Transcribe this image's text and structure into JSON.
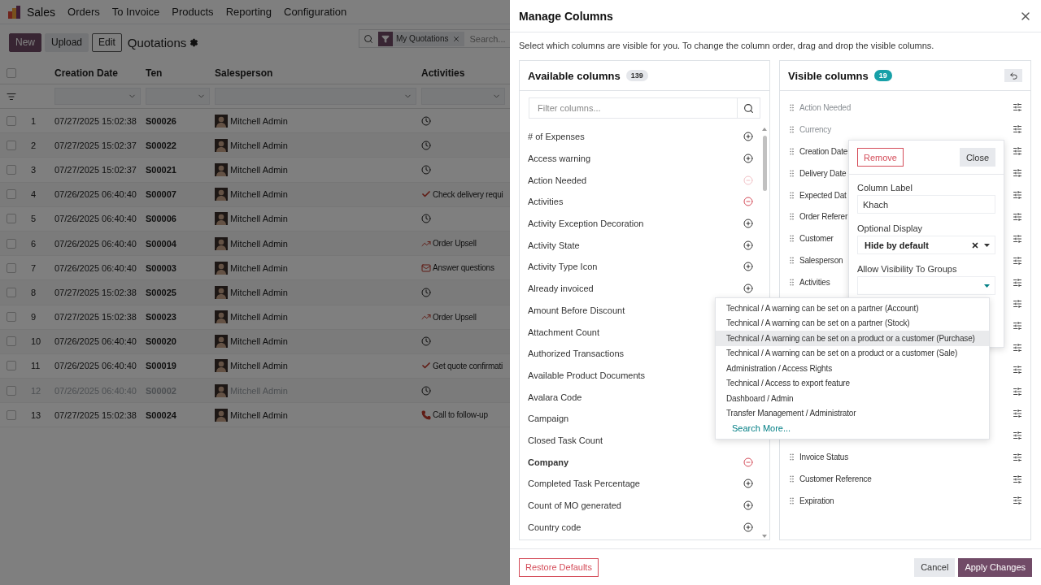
{
  "app": {
    "name": "Sales",
    "menu": [
      "Orders",
      "To Invoice",
      "Products",
      "Reporting",
      "Configuration"
    ]
  },
  "select_all": {
    "checked": false
  },
  "control_panel": {
    "buttons": [
      {
        "label": "New",
        "kind": "primary"
      },
      {
        "label": "Upload",
        "kind": "secondary"
      },
      {
        "label": "Edit",
        "kind": "outline"
      }
    ],
    "title": "Quotations",
    "search": {
      "facet": "My Quotations",
      "placeholder": "Search..."
    }
  },
  "table": {
    "columns": [
      "Creation Date",
      "Ten",
      "Salesperson",
      "Activities"
    ],
    "rows": [
      {
        "index": "1",
        "date": "07/27/2025 15:02:38",
        "ref": "S00026",
        "salesperson": "Mitchell Admin",
        "activity": {
          "kind": "clock"
        },
        "muted": false,
        "checked": false
      },
      {
        "index": "2",
        "date": "07/27/2025 15:02:37",
        "ref": "S00022",
        "salesperson": "Mitchell Admin",
        "activity": {
          "kind": "clock"
        },
        "muted": false,
        "checked": false
      },
      {
        "index": "3",
        "date": "07/27/2025 15:02:37",
        "ref": "S00021",
        "salesperson": "Mitchell Admin",
        "activity": {
          "kind": "clock"
        },
        "muted": false,
        "checked": false
      },
      {
        "index": "4",
        "date": "07/26/2025 06:40:40",
        "ref": "S00007",
        "salesperson": "Mitchell Admin",
        "activity": {
          "kind": "todo",
          "text": "Check delivery requi"
        },
        "muted": false,
        "checked": false
      },
      {
        "index": "5",
        "date": "07/26/2025 06:40:40",
        "ref": "S00006",
        "salesperson": "Mitchell Admin",
        "activity": {
          "kind": "clock"
        },
        "muted": false,
        "checked": false
      },
      {
        "index": "6",
        "date": "07/26/2025 06:40:40",
        "ref": "S00004",
        "salesperson": "Mitchell Admin",
        "activity": {
          "kind": "upsell",
          "text": "Order Upsell"
        },
        "muted": false,
        "checked": false
      },
      {
        "index": "7",
        "date": "07/26/2025 06:40:40",
        "ref": "S00003",
        "salesperson": "Mitchell Admin",
        "activity": {
          "kind": "email",
          "text": "Answer questions"
        },
        "muted": false,
        "checked": false
      },
      {
        "index": "8",
        "date": "07/27/2025 15:02:38",
        "ref": "S00025",
        "salesperson": "Mitchell Admin",
        "activity": {
          "kind": "clock"
        },
        "muted": false,
        "checked": false
      },
      {
        "index": "9",
        "date": "07/27/2025 15:02:38",
        "ref": "S00023",
        "salesperson": "Mitchell Admin",
        "activity": {
          "kind": "upsell",
          "text": "Order Upsell"
        },
        "muted": false,
        "checked": false
      },
      {
        "index": "10",
        "date": "07/26/2025 06:40:40",
        "ref": "S00020",
        "salesperson": "Mitchell Admin",
        "activity": {
          "kind": "clock"
        },
        "muted": false,
        "checked": false
      },
      {
        "index": "11",
        "date": "07/26/2025 06:40:40",
        "ref": "S00019",
        "salesperson": "Mitchell Admin",
        "activity": {
          "kind": "todo",
          "text": "Get quote confirmati"
        },
        "muted": false,
        "checked": false
      },
      {
        "index": "12",
        "date": "07/26/2025 06:40:40",
        "ref": "S00002",
        "salesperson": "Mitchell Admin",
        "activity": {
          "kind": "clock"
        },
        "muted": true,
        "checked": false
      },
      {
        "index": "13",
        "date": "07/27/2025 15:02:38",
        "ref": "S00024",
        "salesperson": "Mitchell Admin",
        "activity": {
          "kind": "call",
          "text": "Call to follow-up"
        },
        "muted": false,
        "checked": false
      }
    ]
  },
  "dialog": {
    "title": "Manage Columns",
    "description": "Select which columns are visible for you. To change the column order, drag and drop the visible columns.",
    "available": {
      "title": "Available columns",
      "count": "139",
      "filter_placeholder": "Filter columns...",
      "items": [
        {
          "label": "# of Expenses",
          "in_view": false,
          "faded": false,
          "bold": false
        },
        {
          "label": "Access warning",
          "in_view": false,
          "faded": false,
          "bold": false
        },
        {
          "label": "Action Needed",
          "in_view": true,
          "faded": true,
          "bold": false
        },
        {
          "label": "Activities",
          "in_view": true,
          "faded": false,
          "bold": false
        },
        {
          "label": "Activity Exception Decoration",
          "in_view": false,
          "faded": false,
          "bold": false
        },
        {
          "label": "Activity State",
          "in_view": false,
          "faded": false,
          "bold": false
        },
        {
          "label": "Activity Type Icon",
          "in_view": false,
          "faded": false,
          "bold": false
        },
        {
          "label": "Already invoiced",
          "in_view": false,
          "faded": false,
          "bold": false
        },
        {
          "label": "Amount Before Discount",
          "bold": false
        },
        {
          "label": "Attachment Count",
          "bold": false
        },
        {
          "label": "Authorized Transactions",
          "bold": false
        },
        {
          "label": "Available Product Documents",
          "bold": false
        },
        {
          "label": "Avalara Code",
          "bold": false
        },
        {
          "label": "Campaign",
          "bold": false
        },
        {
          "label": "Closed Task Count",
          "bold": false
        },
        {
          "label": "Company",
          "in_view": true,
          "faded": false,
          "bold": true
        },
        {
          "label": "Completed Task Percentage",
          "in_view": false,
          "faded": false,
          "bold": false
        },
        {
          "label": "Count of MO generated",
          "in_view": false,
          "faded": false,
          "bold": false
        },
        {
          "label": "Country code",
          "in_view": false,
          "faded": false,
          "bold": false
        }
      ]
    },
    "visible": {
      "title": "Visible columns",
      "count": "19",
      "items": [
        {
          "kind": "column",
          "label": "Action Needed",
          "faded": true
        },
        {
          "kind": "column",
          "label": "Currency",
          "faded": true
        },
        {
          "kind": "column",
          "label": "Creation Date",
          "faded": false
        },
        {
          "kind": "column",
          "label": "Delivery Date",
          "faded": false
        },
        {
          "kind": "column",
          "label": "Expected Dat",
          "faded": false
        },
        {
          "kind": "column",
          "label": "Order Referer",
          "faded": false
        },
        {
          "kind": "column",
          "label": "Customer",
          "faded": false
        },
        {
          "kind": "column",
          "label": "Salesperson",
          "faded": false
        },
        {
          "kind": "column",
          "label": "Activities",
          "faded": false
        },
        {
          "kind": "covered"
        },
        {
          "kind": "covered"
        },
        {
          "kind": "covered"
        },
        {
          "kind": "covered"
        },
        {
          "kind": "covered"
        },
        {
          "kind": "covered"
        },
        {
          "kind": "covered"
        },
        {
          "kind": "column",
          "label": "Invoice Status",
          "faded": false
        },
        {
          "kind": "column",
          "label": "Customer Reference",
          "faded": false
        },
        {
          "kind": "column",
          "label": "Expiration",
          "faded": false
        }
      ]
    },
    "column_popover": {
      "remove": "Remove",
      "close": "Close",
      "fields": [
        {
          "label": "Column Label",
          "kind": "text",
          "value": "Khach"
        },
        {
          "label": "Optional Display",
          "kind": "select",
          "value": "Hide by default",
          "clearable": true
        },
        {
          "label": "Allow Visibility To Groups",
          "kind": "select",
          "clearable": false
        }
      ]
    },
    "group_dropdown": {
      "options": [
        {
          "label": "Technical / A warning can be set on a partner (Account)",
          "highlighted": false
        },
        {
          "label": "Technical / A warning can be set on a partner (Stock)",
          "highlighted": false
        },
        {
          "label": "Technical / A warning can be set on a product or a customer (Purchase)",
          "highlighted": true
        },
        {
          "label": "Technical / A warning can be set on a product or a customer (Sale)",
          "highlighted": false
        },
        {
          "label": "Administration / Access Rights",
          "highlighted": false
        },
        {
          "label": "Technical / Access to export feature",
          "highlighted": false
        },
        {
          "label": "Dashboard / Admin",
          "highlighted": false
        },
        {
          "label": "Transfer Management / Administrator",
          "highlighted": false
        }
      ],
      "search_more": "Search More..."
    },
    "footer": {
      "restore": "Restore Defaults",
      "cancel": "Cancel",
      "apply": "Apply Changes"
    }
  }
}
